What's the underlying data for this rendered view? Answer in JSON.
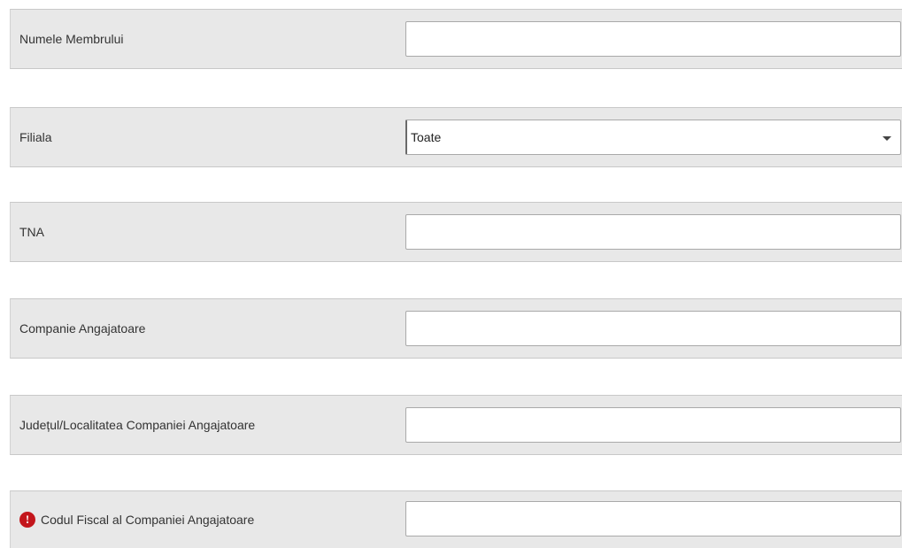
{
  "fields": [
    {
      "label": "Numele Membrului",
      "value": "",
      "placeholder": ""
    },
    {
      "label": "Filiala",
      "selected": "Toate"
    },
    {
      "label": "TNA",
      "value": "",
      "placeholder": ""
    },
    {
      "label": "Companie Angajatoare",
      "value": "",
      "placeholder": ""
    },
    {
      "label": "Județul/Localitatea Companiei Angajatoare",
      "value": "",
      "placeholder": ""
    },
    {
      "label": "Codul Fiscal al Companiei Angajatoare",
      "value": "",
      "placeholder": "",
      "icon": "info-icon",
      "icon_text": "!"
    }
  ],
  "colors": {
    "row_background": "#e8e8e8",
    "info_icon": "#c3161c"
  }
}
